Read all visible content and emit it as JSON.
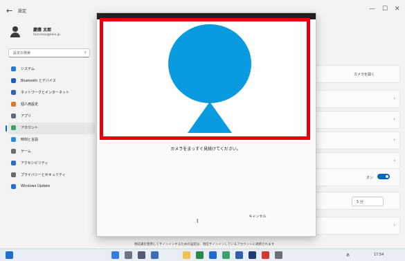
{
  "window": {
    "app_title": "設定",
    "back_icon": "←",
    "controls": [
      "—",
      "☐",
      "✕"
    ]
  },
  "sidebar": {
    "user_name": "慶應 太郎",
    "user_email": "taro.keio@keio.jp",
    "search_placeholder": "設定の検索",
    "search_icon": "⌕",
    "items": [
      {
        "label": "システム",
        "icon": "system-icon",
        "color": "#2b77d4",
        "selected": false
      },
      {
        "label": "Bluetooth とデバイス",
        "icon": "bluetooth-icon",
        "color": "#1f5fb8",
        "selected": false
      },
      {
        "label": "ネットワークとインターネット",
        "icon": "network-icon",
        "color": "#3561a8",
        "selected": false
      },
      {
        "label": "個人用設定",
        "icon": "brush-icon",
        "color": "#d97a2b",
        "selected": false
      },
      {
        "label": "アプリ",
        "icon": "apps-icon",
        "color": "#5a6b82",
        "selected": false
      },
      {
        "label": "アカウント",
        "icon": "account-icon",
        "color": "#3aa36b",
        "selected": true
      },
      {
        "label": "時刻と言語",
        "icon": "globe-icon",
        "color": "#2a8fd6",
        "selected": false
      },
      {
        "label": "ゲーム",
        "icon": "game-icon",
        "color": "#6b6b6b",
        "selected": false
      },
      {
        "label": "アクセシビリティ",
        "icon": "accessibility-icon",
        "color": "#2f6fc0",
        "selected": false
      },
      {
        "label": "プライバシーとセキュリティ",
        "icon": "shield-icon",
        "color": "#6b6b6b",
        "selected": false
      },
      {
        "label": "Windows Update",
        "icon": "update-icon",
        "color": "#1f6fd1",
        "selected": false
      }
    ]
  },
  "content": {
    "right_label_1": "カメラを開く",
    "toggle_label": "オン",
    "dropdown_value": "5 分"
  },
  "dialog": {
    "instruction": "カメラをまっすぐ見続けてください。",
    "cancel_label": "キャンセル",
    "silhouette_color": "#0a9ae0",
    "frame_color": "#e3000f"
  },
  "footer_text": "顔認識を使用してサインインするための設定は、現在サインインしているアカウントに適用されます",
  "taskbar": {
    "tray_text": "あ",
    "time": "17:54"
  }
}
